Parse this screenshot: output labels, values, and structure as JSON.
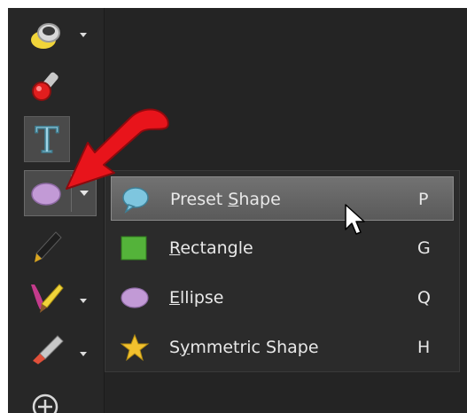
{
  "toolbar": {
    "tools": [
      {
        "name": "fill-tool",
        "icon": "paint-bucket-icon",
        "has_dropdown": true
      },
      {
        "name": "red-eye-tool",
        "icon": "red-eye-icon",
        "has_dropdown": false
      },
      {
        "name": "text-tool",
        "icon": "text-t-icon",
        "label": "T",
        "has_dropdown": false
      },
      {
        "name": "shape-tool",
        "icon": "ellipse-icon",
        "has_dropdown": true,
        "selected": true
      },
      {
        "name": "pen-tool",
        "icon": "pen-icon",
        "has_dropdown": false
      },
      {
        "name": "brush-tool",
        "icon": "brush-icon",
        "has_dropdown": true
      },
      {
        "name": "eraser-tool",
        "icon": "eraser-icon",
        "has_dropdown": true
      },
      {
        "name": "add-tool",
        "icon": "plus-circle-icon",
        "has_dropdown": false
      }
    ]
  },
  "shape_menu": {
    "items": [
      {
        "label": "Preset Shape",
        "mnemonic": "S",
        "shortcut": "P",
        "icon": "speech-bubble-icon",
        "highlighted": true
      },
      {
        "label": "Rectangle",
        "mnemonic": "R",
        "shortcut": "G",
        "icon": "rectangle-icon",
        "highlighted": false
      },
      {
        "label": "Ellipse",
        "mnemonic": "E",
        "shortcut": "Q",
        "icon": "ellipse-icon",
        "highlighted": false
      },
      {
        "label": "Symmetric Shape",
        "mnemonic": "y",
        "shortcut": "H",
        "icon": "star-icon",
        "highlighted": false
      }
    ]
  },
  "colors": {
    "panel": "#242424",
    "menu": "#2b2b2b",
    "highlight": "#666666",
    "text": "#e8e8e8",
    "annotation_arrow": "#e8141b",
    "rectangle": "#54b33a",
    "ellipse": "#c29ad6",
    "star": "#f2c12e",
    "bubble": "#7ec6df"
  }
}
